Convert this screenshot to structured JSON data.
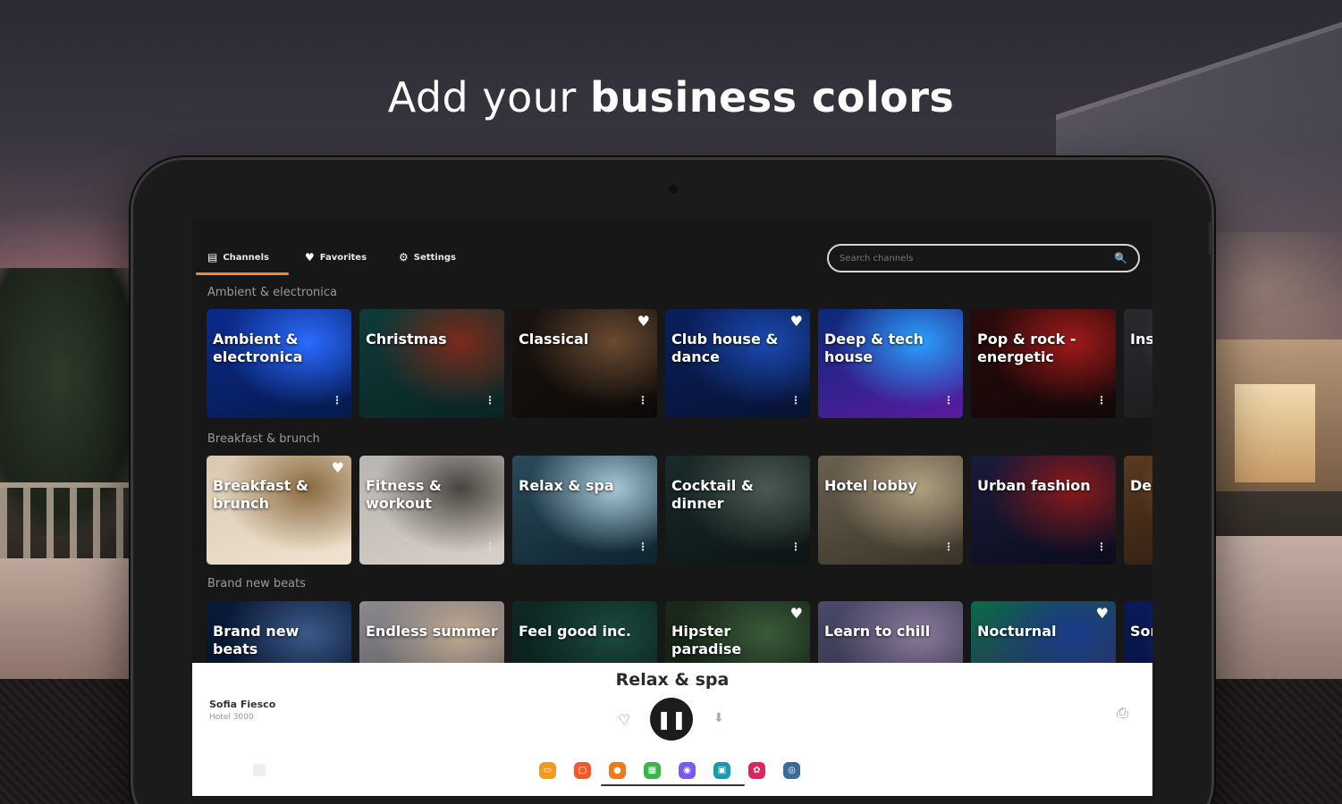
{
  "headline": {
    "light": "Add your",
    "bold": "business colors"
  },
  "nav": {
    "tabs": [
      {
        "label": "Channels",
        "icon": "channels-icon",
        "glyph": "▤"
      },
      {
        "label": "Favorites",
        "icon": "heart-icon",
        "glyph": "♥"
      },
      {
        "label": "Settings",
        "icon": "gear-icon",
        "glyph": "⚙"
      }
    ],
    "active_tab": "Channels",
    "accent": "#f08a2c",
    "search_placeholder": "Search channels",
    "search_icon": "🔍"
  },
  "sections": [
    {
      "label": "Ambient & electronica",
      "cards": [
        {
          "title": "Ambient & electronica",
          "favorite": false,
          "colors": [
            "#0a2b8c",
            "#2a6bff",
            "#061a4d"
          ]
        },
        {
          "title": "Christmas",
          "favorite": false,
          "colors": [
            "#0f3b3a",
            "#7a2a1a",
            "#0a2424"
          ]
        },
        {
          "title": "Classical",
          "favorite": true,
          "colors": [
            "#1a1410",
            "#6a4a30",
            "#0c0a08"
          ]
        },
        {
          "title": "Club house & dance",
          "favorite": true,
          "colors": [
            "#0a1f5c",
            "#1a4ab0",
            "#081233"
          ]
        },
        {
          "title": "Deep & tech house",
          "favorite": false,
          "colors": [
            "#0a2a7a",
            "#2aa0ff",
            "#5a1aa0"
          ]
        },
        {
          "title": "Pop & rock - energetic",
          "favorite": false,
          "colors": [
            "#2a0a0a",
            "#a01a1a",
            "#120808"
          ]
        },
        {
          "title": "Ins",
          "favorite": false,
          "colors": [
            "#2a2a2e",
            "#555",
            "#1a1a1c"
          ]
        }
      ]
    },
    {
      "label": "Breakfast & brunch",
      "cards": [
        {
          "title": "Breakfast & brunch",
          "favorite": true,
          "colors": [
            "#d8c8b0",
            "#8a6a40",
            "#f0e4d0"
          ]
        },
        {
          "title": "Fitness & workout",
          "favorite": false,
          "colors": [
            "#b8b4b0",
            "#4a4440",
            "#d8d0c8"
          ]
        },
        {
          "title": "Relax & spa",
          "favorite": false,
          "colors": [
            "#2a4a5a",
            "#a8c8d8",
            "#0e2430"
          ]
        },
        {
          "title": "Cocktail & dinner",
          "favorite": false,
          "colors": [
            "#1a2a2a",
            "#4a5a50",
            "#0c1414"
          ]
        },
        {
          "title": "Hotel lobby",
          "favorite": false,
          "colors": [
            "#6a6050",
            "#b0a080",
            "#3a3428"
          ]
        },
        {
          "title": "Urban fashion",
          "favorite": false,
          "colors": [
            "#1a1a3a",
            "#8a1a1a",
            "#0c0c1c"
          ]
        },
        {
          "title": "Des fur",
          "favorite": false,
          "colors": [
            "#5a3a20",
            "#a06a3a",
            "#2a1a10"
          ]
        }
      ]
    },
    {
      "label": "Brand new beats",
      "cards": [
        {
          "title": "Brand new beats",
          "favorite": false,
          "colors": [
            "#0a1a3a",
            "#3a5a8a",
            "#050c1c"
          ]
        },
        {
          "title": "Endless summer",
          "favorite": false,
          "colors": [
            "#8a8a90",
            "#c0a890",
            "#4a4a50"
          ]
        },
        {
          "title": "Feel good inc.",
          "favorite": false,
          "colors": [
            "#0e2a26",
            "#1a4a40",
            "#081814"
          ]
        },
        {
          "title": "Hipster paradise",
          "favorite": true,
          "colors": [
            "#1a2a1a",
            "#3a5a3a",
            "#0c140c"
          ]
        },
        {
          "title": "Learn to chill",
          "favorite": false,
          "colors": [
            "#4a4a6a",
            "#8a7a9a",
            "#2a2a3a"
          ]
        },
        {
          "title": "Nocturnal",
          "favorite": true,
          "colors": [
            "#0a6a4a",
            "#1a3a8a",
            "#3a1a5a"
          ]
        },
        {
          "title": "Sor sou",
          "favorite": false,
          "colors": [
            "#0a1a5a",
            "#2a3aa0",
            "#050c2c"
          ]
        }
      ]
    }
  ],
  "player": {
    "now_playing": "Relax & spa",
    "user_name": "Sofia Fiesco",
    "user_sub": "Hotel 3000",
    "pause_glyph": "❚❚",
    "heart_glyph": "♡",
    "download_glyph": "⬇",
    "cast_glyph": "⎙",
    "swatches": [
      {
        "name": "orange",
        "color": "#f59a1c",
        "glyph": "▭"
      },
      {
        "name": "red-orange",
        "color": "#f05a2a",
        "glyph": "▢"
      },
      {
        "name": "orange-person",
        "color": "#f07a1a",
        "glyph": "●"
      },
      {
        "name": "green",
        "color": "#3cb44a",
        "glyph": "▦"
      },
      {
        "name": "purple",
        "color": "#7a5af0",
        "glyph": "◉"
      },
      {
        "name": "teal",
        "color": "#1a9ab0",
        "glyph": "▣"
      },
      {
        "name": "magenta",
        "color": "#e0245e",
        "glyph": "✿"
      },
      {
        "name": "steel-blue",
        "color": "#3a6a9a",
        "glyph": "◎"
      }
    ]
  }
}
